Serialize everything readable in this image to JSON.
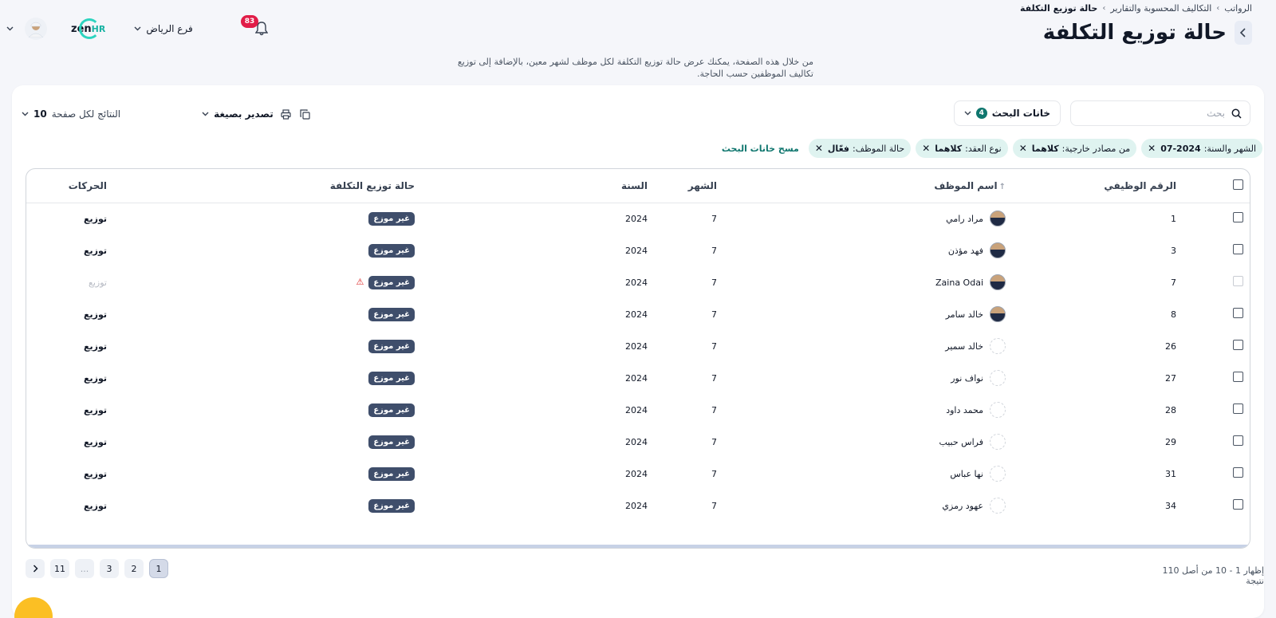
{
  "breadcrumb": {
    "items": [
      "الرواتب",
      "التكاليف المحسوبة والتقارير"
    ],
    "current": "حالة توزيع التكلفة",
    "separator": "›"
  },
  "page": {
    "title": "حالة توزيع التكلفة",
    "description": "من خلال هذه الصفحة، يمكنك عرض حالة توزيع التكلفة لكل موظف لشهر معين، بالإضافة إلى توزيع تكاليف الموظفين حسب الحاجة.",
    "back_icon": "chevron-left-icon"
  },
  "header": {
    "branch": "فرع الرياض",
    "notifications_count": "83",
    "logo_text": "zen",
    "logo_suffix": "HR"
  },
  "search": {
    "placeholder": "بحث"
  },
  "filters": {
    "label": "خانات البحث",
    "count": "4",
    "chips": [
      {
        "label": "الشهر والسنة:",
        "value": "07-2024"
      },
      {
        "label": "من مصادر خارجية:",
        "value": "كلاهما"
      },
      {
        "label": "نوع العقد:",
        "value": "كلاهما"
      },
      {
        "label": "حالة الموظف:",
        "value": "فعّال"
      }
    ],
    "clear_label": "مسح خانات البحث"
  },
  "toolbar": {
    "export_label": "تصدير بصيغة",
    "per_page_label": "النتائج لكل صفحة",
    "per_page_value": "10"
  },
  "table": {
    "columns": {
      "employee_id": "الرقم الوظيفي",
      "employee_name": "اسم الموظف",
      "month": "الشهر",
      "year": "السنة",
      "status": "حالة توزيع التكلفة",
      "actions": "الحركات"
    },
    "rows": [
      {
        "id": "1",
        "name": "مراد رامي",
        "month": "7",
        "year": "2024",
        "status": "غير موزع",
        "action": "توزيع"
      },
      {
        "id": "3",
        "name": "فهد مؤذن",
        "month": "7",
        "year": "2024",
        "status": "غير موزع",
        "action": "توزيع"
      },
      {
        "id": "7",
        "name": "Zaina Odai",
        "month": "7",
        "year": "2024",
        "status": "غير موزع",
        "action": "توزيع"
      },
      {
        "id": "8",
        "name": "خالد سامر",
        "month": "7",
        "year": "2024",
        "status": "غير موزع",
        "action": "توزيع"
      },
      {
        "id": "26",
        "name": "خالد سمير",
        "month": "7",
        "year": "2024",
        "status": "غير موزع",
        "action": "توزيع"
      },
      {
        "id": "27",
        "name": "نواف نور",
        "month": "7",
        "year": "2024",
        "status": "غير موزع",
        "action": "توزيع"
      },
      {
        "id": "28",
        "name": "محمد داود",
        "month": "7",
        "year": "2024",
        "status": "غير موزع",
        "action": "توزيع"
      },
      {
        "id": "29",
        "name": "فراس حبيب",
        "month": "7",
        "year": "2024",
        "status": "غير موزع",
        "action": "توزيع"
      },
      {
        "id": "31",
        "name": "نها عباس",
        "month": "7",
        "year": "2024",
        "status": "غير موزع",
        "action": "توزيع"
      },
      {
        "id": "34",
        "name": "عهود رمزي",
        "month": "7",
        "year": "2024",
        "status": "غير موزع",
        "action": "توزيع"
      }
    ]
  },
  "pagination": {
    "pages": [
      "1",
      "2",
      "3",
      "...",
      "11"
    ],
    "results_text": "إظهار 1 - 10 من أصل 110 نتيجة"
  },
  "colors": {
    "accent": "#0f766e",
    "badge": "#3f4e6b",
    "notification": "#e11d48",
    "fab": "#fbbf24"
  }
}
